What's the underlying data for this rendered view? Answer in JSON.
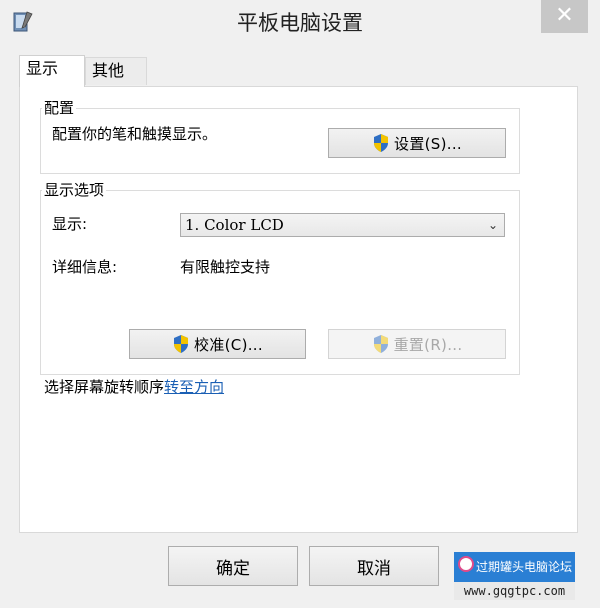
{
  "window": {
    "title": "平板电脑设置",
    "close_label": "✕"
  },
  "tabs": [
    {
      "label": "显示"
    },
    {
      "label": "其他"
    }
  ],
  "config_group": {
    "legend": "配置",
    "description": "配置你的笔和触摸显示。",
    "setup_button": "设置(S)..."
  },
  "display_options": {
    "legend": "显示选项",
    "display_label": "显示:",
    "display_value": "1. Color LCD",
    "details_label": "详细信息:",
    "details_value": "有限触控支持",
    "calibrate_button": "校准(C)...",
    "reset_button": "重置(R)..."
  },
  "rotation": {
    "text": "选择屏幕旋转顺序",
    "link": "转至方向"
  },
  "footer": {
    "ok_button": "确定",
    "cancel_button": "取消"
  },
  "watermark": {
    "line1": "过期罐头电脑论坛",
    "line2": "www.gqgtpc.com"
  },
  "colors": {
    "link": "#1a5fb4",
    "watermark_bg": "#2a7fd4"
  }
}
